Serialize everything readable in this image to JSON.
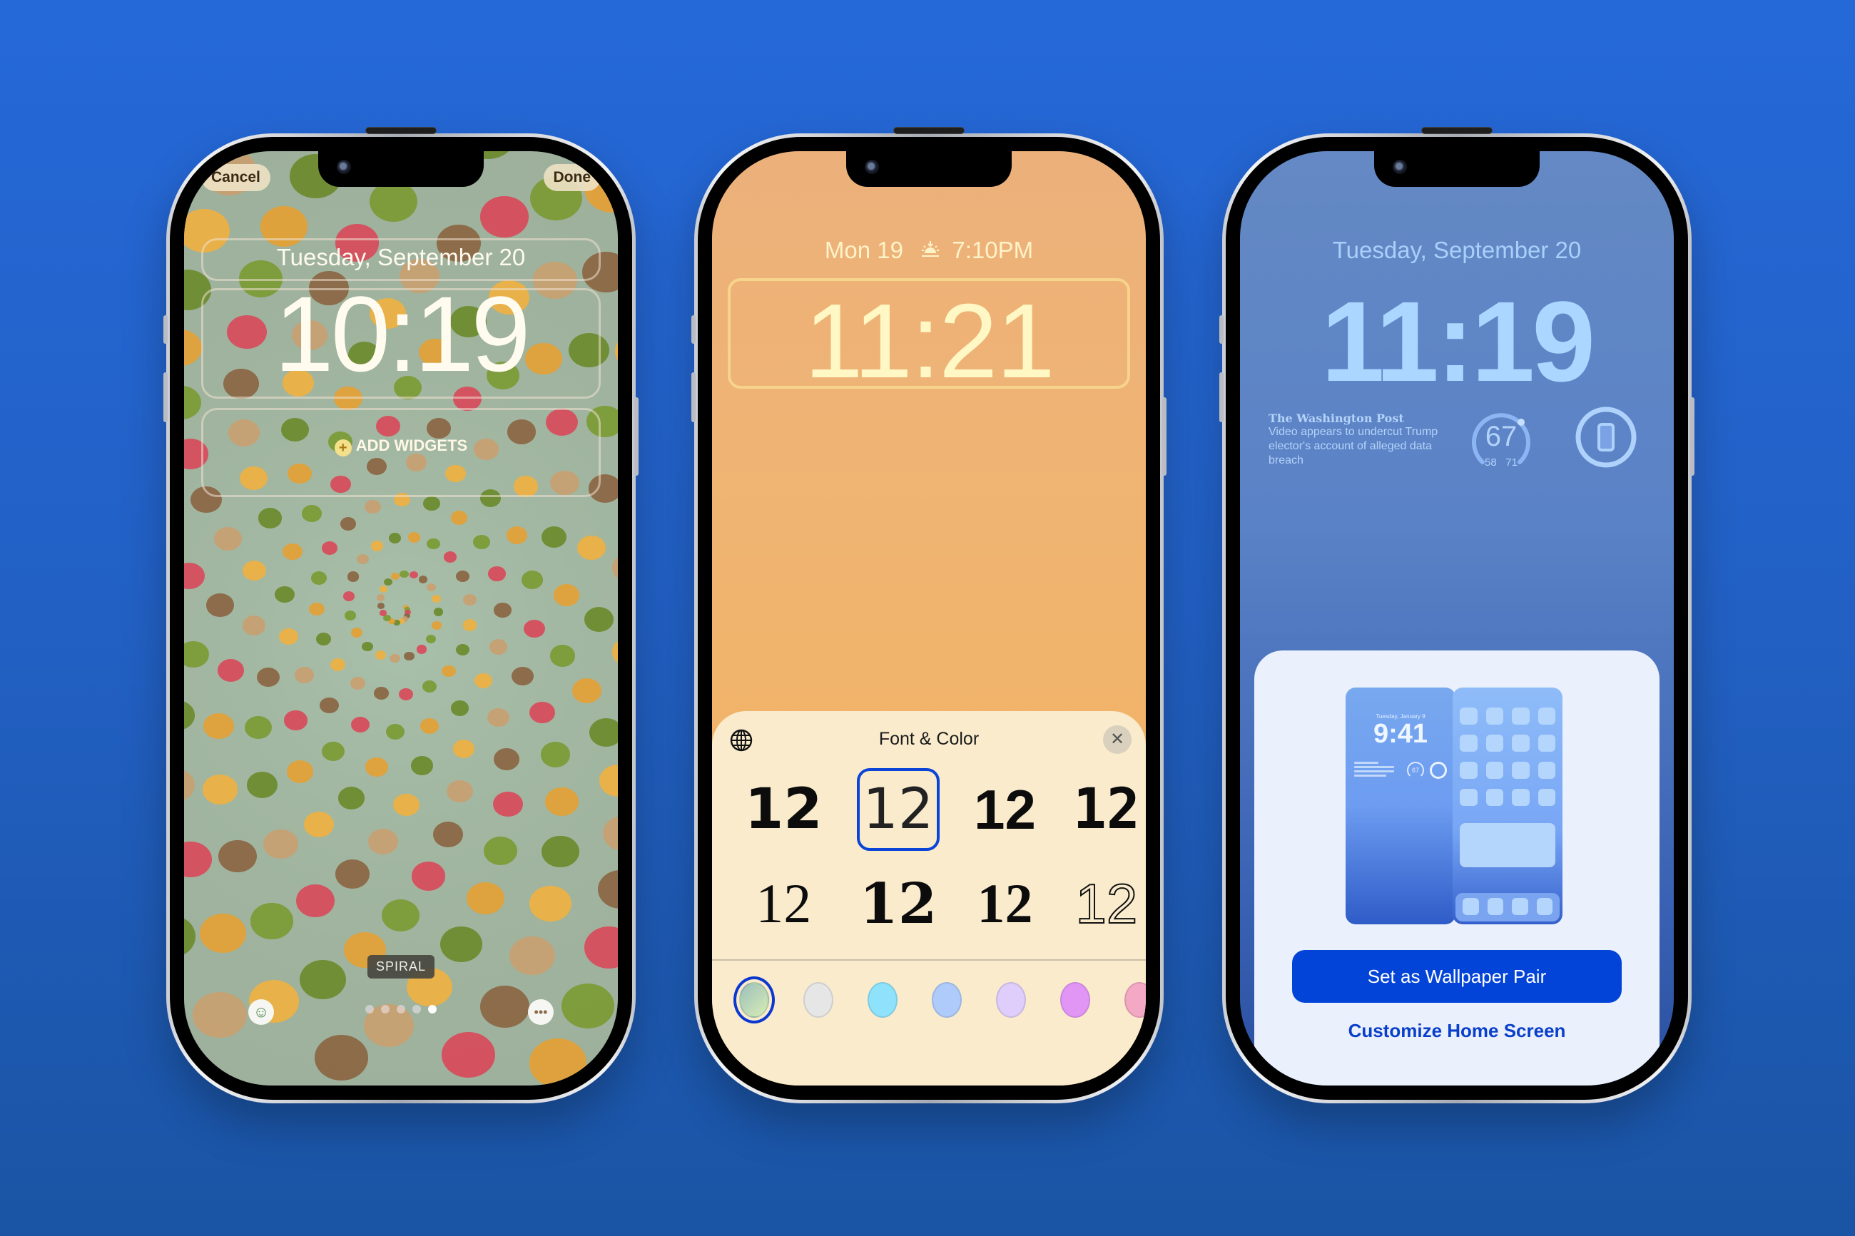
{
  "background": {
    "top_color": "#2568d8",
    "bottom_color": "#1a54a4"
  },
  "phone1": {
    "cancel_label": "Cancel",
    "done_label": "Done",
    "date": "Tuesday, September 20",
    "time": "10:19",
    "add_widgets_label": "ADD WIDGETS",
    "style_label": "SPIRAL",
    "emoji_button_icon": "smiley-face-icon",
    "more_button_icon": "ellipsis-icon",
    "page_dots": {
      "count": 5,
      "active_index": 4
    }
  },
  "phone2": {
    "date": "Mon 19",
    "sunset_icon": "sunset-icon",
    "sunset_time": "7:10PM",
    "time": "11:21",
    "sheet": {
      "title": "Font & Color",
      "globe_icon": "globe-icon",
      "close_icon": "close-icon",
      "font_options": [
        {
          "sample": "12",
          "selected": false
        },
        {
          "sample": "12",
          "selected": true
        },
        {
          "sample": "12",
          "selected": false
        },
        {
          "sample": "12",
          "selected": false
        },
        {
          "sample": "12",
          "selected": false
        },
        {
          "sample": "12",
          "selected": false
        },
        {
          "sample": "12",
          "selected": false
        },
        {
          "sample": "12",
          "selected": false
        }
      ],
      "colors": [
        {
          "hex": "#b9d8c0",
          "selected": true
        },
        {
          "hex": "#e6e6e6",
          "selected": false
        },
        {
          "hex": "#8fe2fb",
          "selected": false
        },
        {
          "hex": "#aecbfb",
          "selected": false
        },
        {
          "hex": "#dfcdfb",
          "selected": false
        },
        {
          "hex": "#e196f6",
          "selected": false
        },
        {
          "hex": "#f3a9c4",
          "selected": false
        }
      ],
      "selected_border_color": "#0b45d8"
    }
  },
  "phone3": {
    "date": "Tuesday, September 20",
    "time": "11:19",
    "news_widget": {
      "source": "The Washington Post",
      "headline": "Video appears to undercut Trump elector's account of alleged data breach"
    },
    "weather_widget": {
      "temp": "67",
      "low": "58",
      "high": "71"
    },
    "battery_widget_icon": "phone-icon",
    "preview": {
      "lock_date": "Tuesday, January 9",
      "lock_time": "9:41",
      "lock_gauge": "67",
      "home_app_count": 16,
      "dock_app_count": 4
    },
    "primary_button_label": "Set as Wallpaper Pair",
    "secondary_button_label": "Customize Home Screen",
    "accent_color": "#0344d8"
  }
}
